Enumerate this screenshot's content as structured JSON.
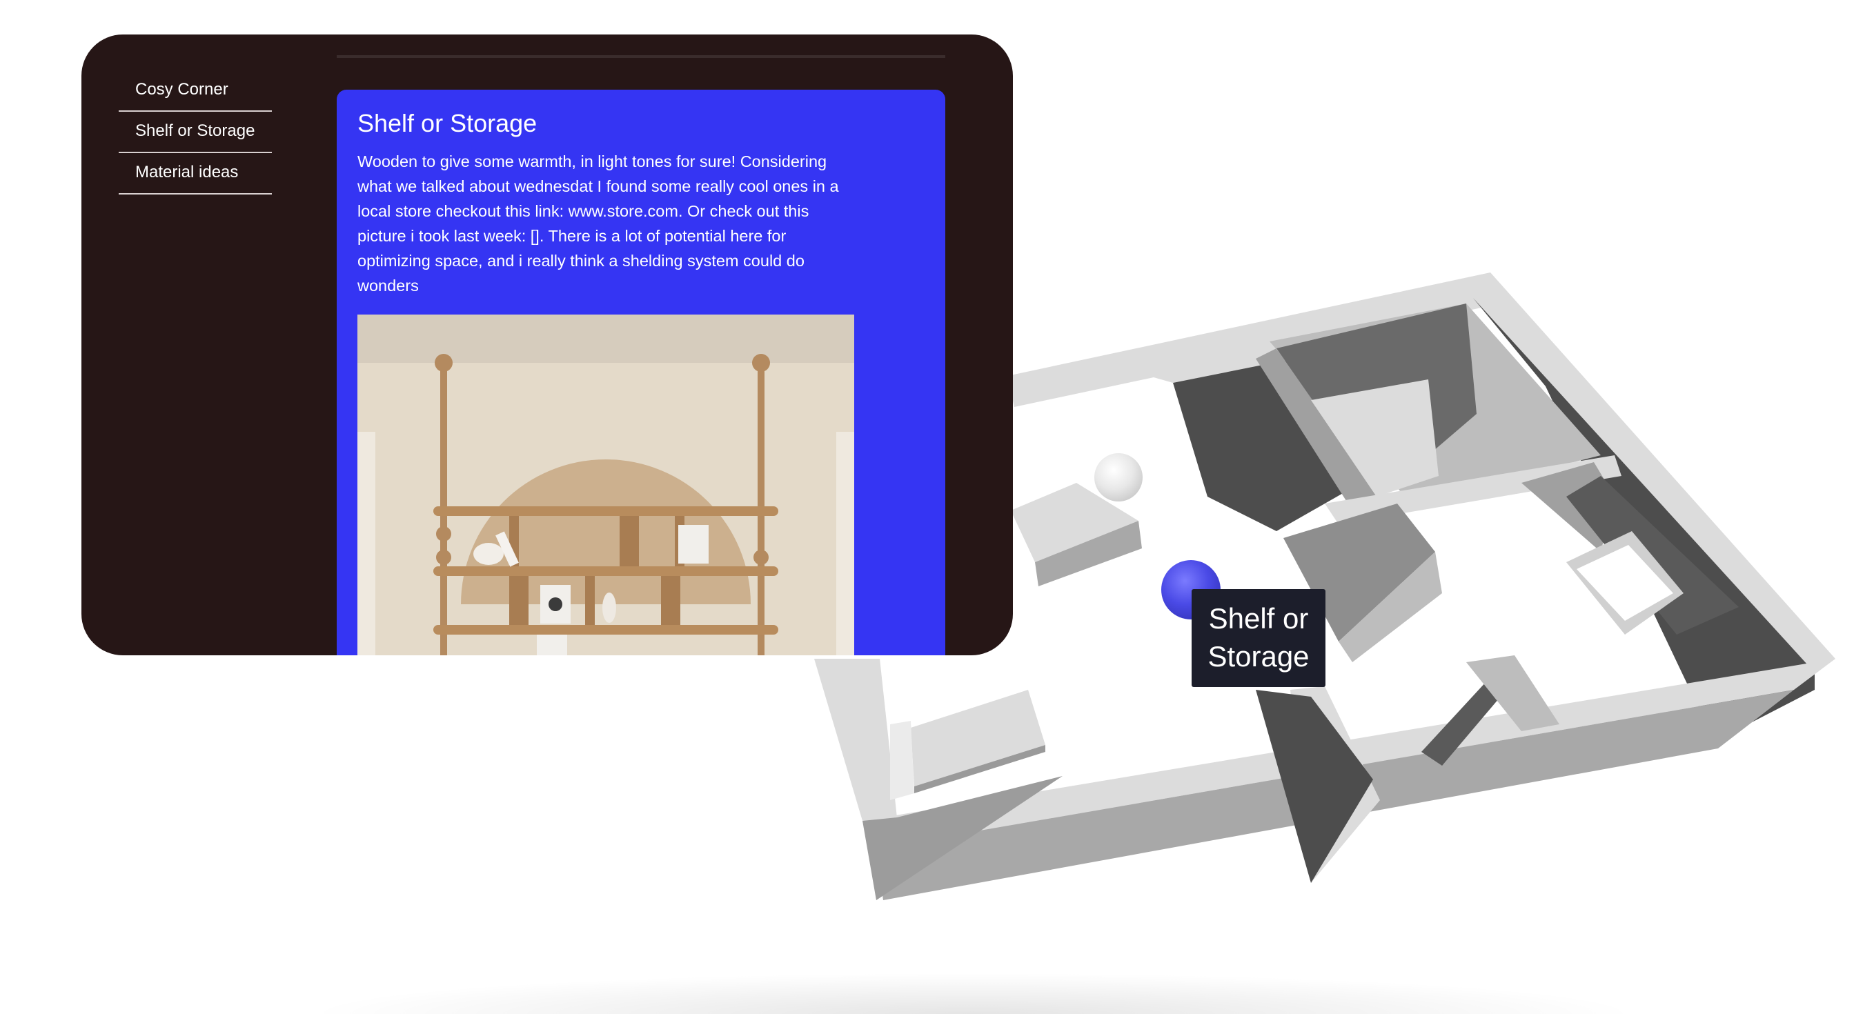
{
  "sidebar": {
    "items": [
      {
        "label": "Cosy Corner"
      },
      {
        "label": "Shelf or Storage"
      },
      {
        "label": "Material ideas"
      }
    ]
  },
  "card": {
    "title": "Shelf or Storage",
    "body": "Wooden to give some warmth, in light tones for sure! Considering what we talked about wednesdat I found some really cool ones in a local store checkout this link: www.store.com. Or check out this picture i took last week: []. There is a lot of potential here for optimizing space, and i really think a shelding system could do wonders"
  },
  "tooltip": {
    "text": "Shelf or Storage"
  },
  "colors": {
    "panel_bg": "#261616",
    "card_bg": "#3535f3",
    "tooltip_bg": "#1c1e2b",
    "marker_active": "#4a4ae6",
    "marker_inactive": "#e8e8e8"
  }
}
